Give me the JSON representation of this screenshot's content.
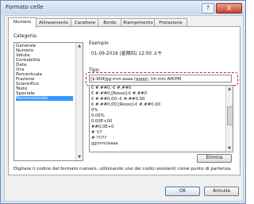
{
  "window": {
    "title": "Formato celle",
    "help_glyph": "?",
    "close_glyph": "X"
  },
  "tabs": [
    "Numero",
    "Allineamento",
    "Carattere",
    "Bordo",
    "Riempimento",
    "Protezione"
  ],
  "left": {
    "category_label": "Categoria:",
    "categories": [
      "Generale",
      "Numero",
      "Valuta",
      "Contabilità",
      "Data",
      "Ora",
      "Percentuale",
      "Frazione",
      "Scientifico",
      "Testo",
      "Speciale",
      "Personalizzato"
    ],
    "selected_category": "Personalizzato"
  },
  "right": {
    "sample_label": "Esempio",
    "sample_value": "01-09-2016 (星期四) 12:00 上午",
    "type_label": "Tipo:",
    "type_value": "[$-804]gg-mm-aaaa (gggg), hh:mm AM/PM",
    "formats": [
      "€ #.##0;-€ #.##0",
      "€ #.##0;[Rosso]-€ #.##0",
      "€ #.##0,00;-€ #.##0,00",
      "€ #.##0,00;[Rosso]-€ #.##0,00",
      "0%",
      "0.00%",
      "0.00E+00",
      "##0,0E+0",
      "# ?/?",
      "# ??/??",
      "gg/mm/aaaa"
    ],
    "delete_button": "Elimina"
  },
  "description": "Digitare il codice del formato numero, utilizzando uno dei codici esistenti come punto di partenza.",
  "buttons": {
    "ok": "OK",
    "cancel": "Annulla"
  },
  "icons": {
    "scroll_up": "▲",
    "scroll_down": "▼"
  },
  "colors": {
    "selection": "#3399ff",
    "highlight": "#d21f1f",
    "close": "#c8402b"
  }
}
